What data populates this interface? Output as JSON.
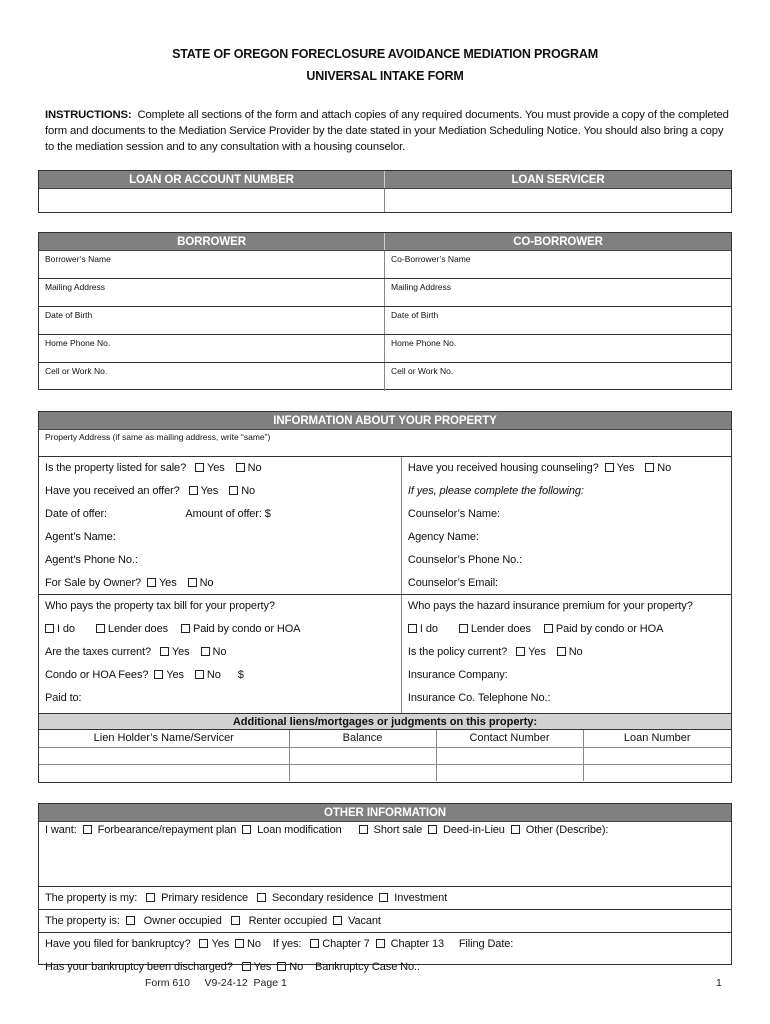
{
  "header": {
    "title_line1": "STATE OF OREGON FORECLOSURE AVOIDANCE MEDIATION PROGRAM",
    "title_line2": "UNIVERSAL INTAKE FORM"
  },
  "instructions": {
    "label": "INSTRUCTIONS:",
    "text": "Complete all sections of the form and attach copies of any required documents. You must provide a copy of the completed form and documents to the Mediation Service Provider by the date stated in your Mediation Scheduling Notice. You should also bring a copy to the mediation session and to any consultation with a housing counselor."
  },
  "loan": {
    "account_header": "LOAN OR ACCOUNT NUMBER",
    "servicer_header": "LOAN SERVICER",
    "account_value": "",
    "servicer_value": ""
  },
  "borrowers": {
    "borrower_header": "BORROWER",
    "coborrower_header": "CO-BORROWER",
    "rows": [
      {
        "left": "Borrower’s Name",
        "right": "Co-Borrower’s Name"
      },
      {
        "left": "Mailing Address",
        "right": "Mailing Address"
      },
      {
        "left": "Date of Birth",
        "right": "Date of Birth"
      },
      {
        "left": "Home Phone No.",
        "right": "Home Phone No."
      },
      {
        "left": "Cell or Work No.",
        "right": "Cell or Work No."
      }
    ]
  },
  "property": {
    "header": "INFORMATION ABOUT YOUR PROPERTY",
    "address_label": "Property Address (if same as mailing address, write “same”)",
    "listed_for_sale": "Is the property listed for sale?",
    "received_offer": "Have you received an offer?",
    "date_of_offer": "Date of offer:",
    "amount_of_offer": "Amount of offer: $",
    "agent_name": "Agent’s Name:",
    "agent_phone": "Agent’s Phone No.:",
    "for_sale_by_owner": "For Sale by Owner?",
    "housing_counseling": "Have you received housing counseling?",
    "if_yes": "If yes, please complete the following:",
    "counselor_name": "Counselor’s Name:",
    "agency_name": "Agency Name:",
    "counselor_phone": "Counselor’s Phone No.:",
    "counselor_email": "Counselor’s Email:",
    "tax_question": "Who pays the property tax bill for your property?",
    "insurance_question": "Who pays the hazard insurance premium for your property?",
    "payer_options": [
      "I do",
      "Lender does",
      "Paid by condo or HOA"
    ],
    "taxes_current": "Are the taxes current?",
    "policy_current": "Is the policy current?",
    "hoa_fees": "Condo or HOA Fees?",
    "dollar": "$",
    "paid_to": "Paid to:",
    "insurance_company": "Insurance Company:",
    "insurance_phone": "Insurance Co. Telephone No.:",
    "yes": "Yes",
    "no": "No"
  },
  "liens": {
    "header": "Additional liens/mortgages or judgments on this property:",
    "columns": [
      "Lien Holder’s Name/Servicer",
      "Balance",
      "Contact Number",
      "Loan Number"
    ],
    "rows": [
      [
        "",
        "",
        "",
        ""
      ],
      [
        "",
        "",
        "",
        ""
      ]
    ]
  },
  "other": {
    "header": "OTHER INFORMATION",
    "want_label": "I want:",
    "want_options": [
      "Forbearance/repayment plan",
      "Loan modification",
      "Short sale",
      "Deed-in-Lieu",
      "Other (Describe):"
    ],
    "property_is_my_label": "The property is my:",
    "property_is_my_options": [
      "Primary residence",
      "Secondary residence",
      "Investment"
    ],
    "property_is_label": "The property is:",
    "property_is_options": [
      "Owner occupied",
      "Renter occupied",
      "Vacant"
    ],
    "bankruptcy_filed": "Have you filed for bankruptcy?",
    "if_yes": "If yes:",
    "chapter7": "Chapter 7",
    "chapter13": "Chapter 13",
    "filing_date": "Filing Date:",
    "bankruptcy_discharged": "Has your bankruptcy been discharged?",
    "case_no": "Bankruptcy Case No.:",
    "yes": "Yes",
    "no": "No"
  },
  "footer": {
    "form_info": "Form 610     V9-24-12  Page 1",
    "page_number": "1"
  }
}
